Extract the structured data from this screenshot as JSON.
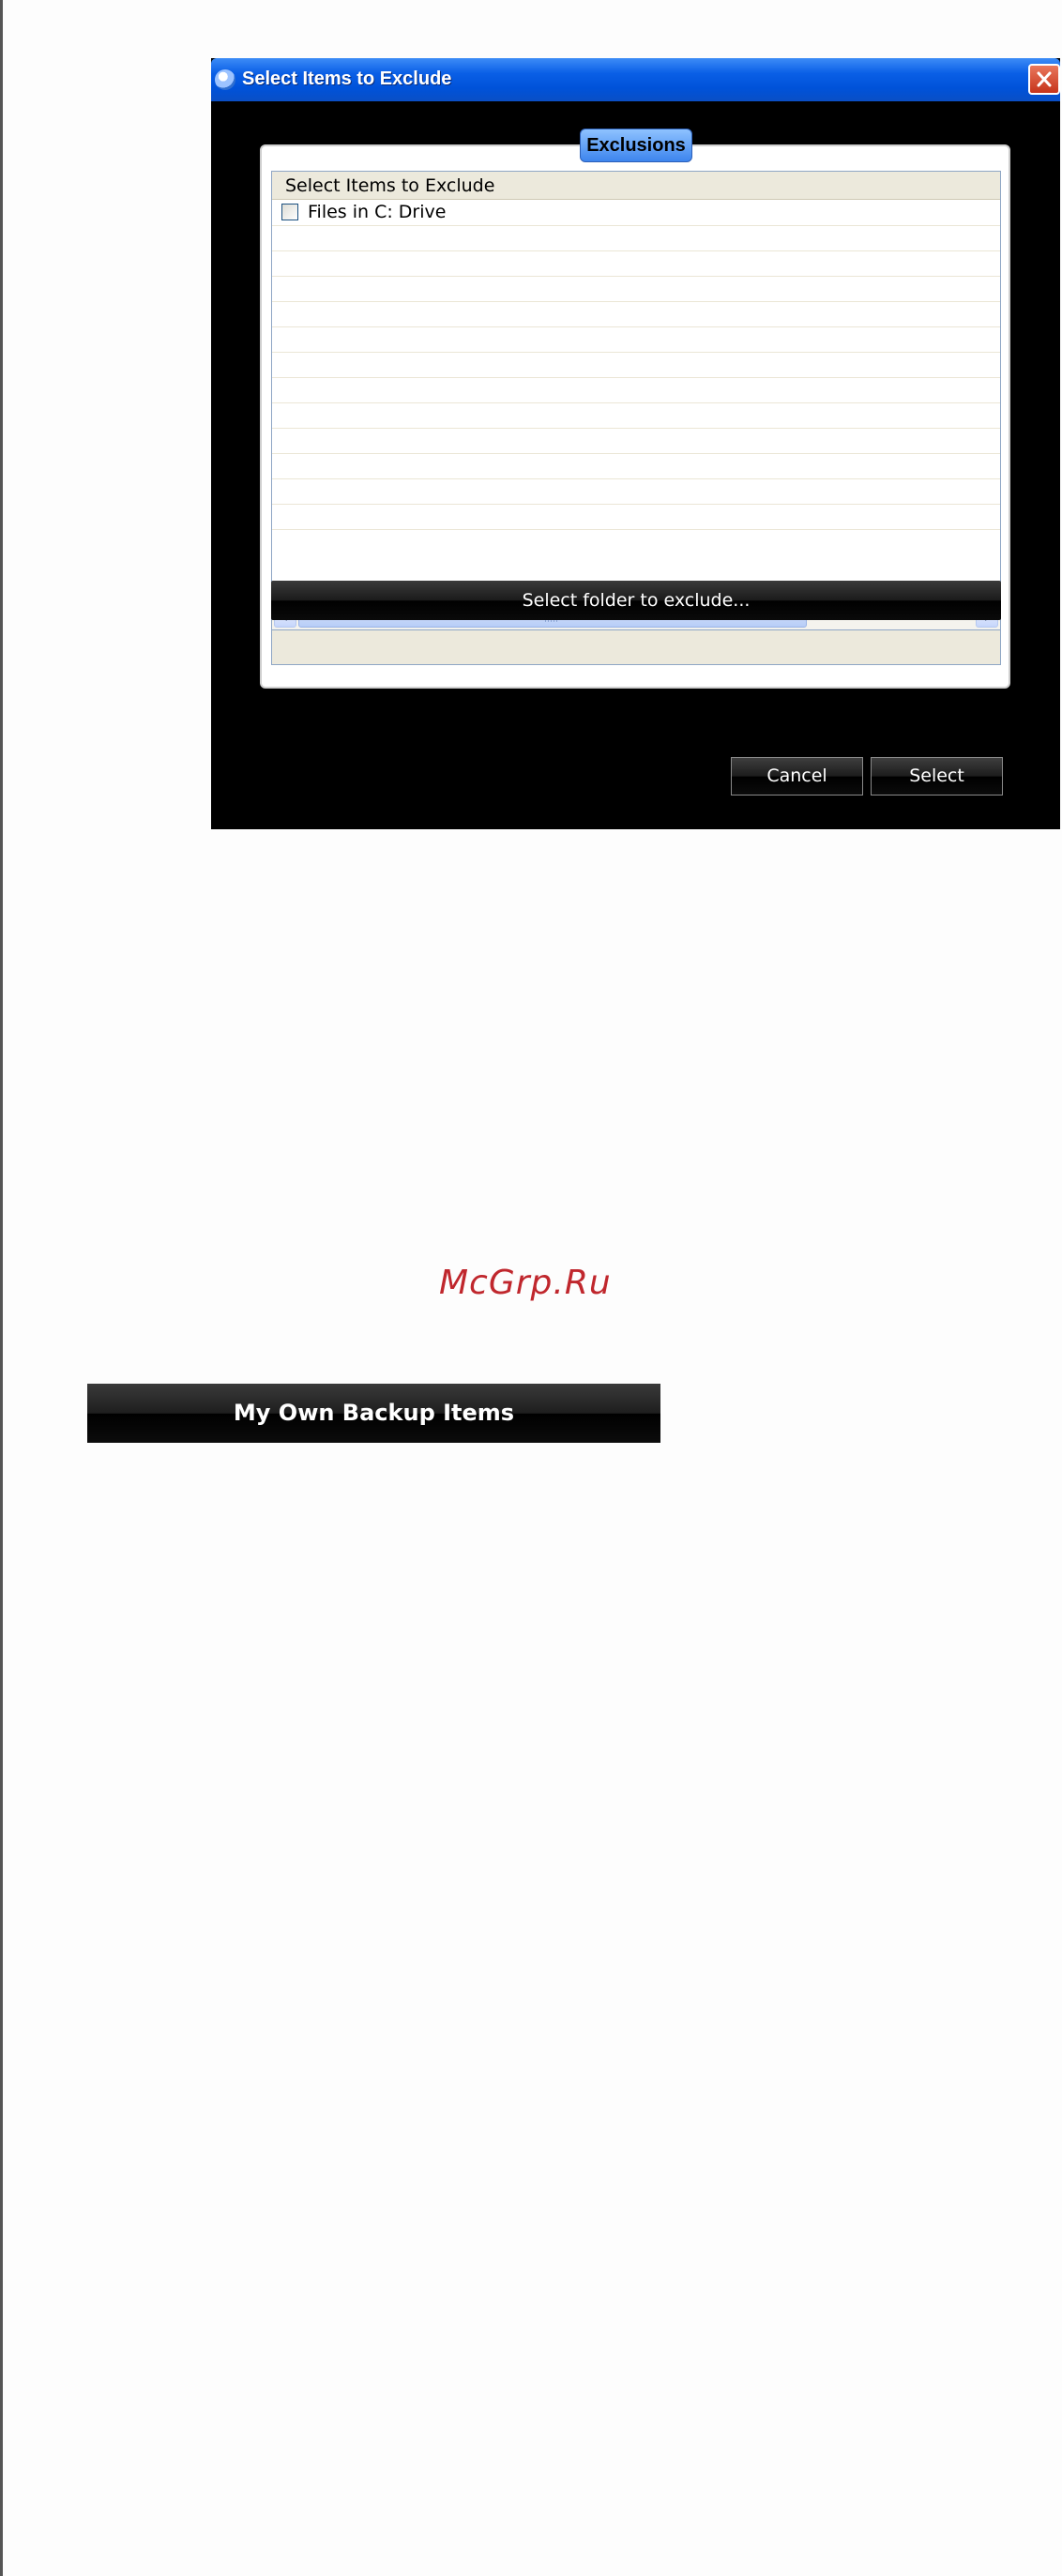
{
  "dialog": {
    "title": "Select Items to Exclude",
    "tab_label": "Exclusions",
    "list": {
      "header": "Select Items to Exclude",
      "items": [
        {
          "label": "Files in C: Drive",
          "checked": false
        }
      ]
    },
    "select_folder_label": "Select folder to exclude...",
    "path_value": "",
    "cancel_label": "Cancel",
    "select_label": "Select"
  },
  "watermark": "McGrp.Ru",
  "section_bar": {
    "label": "My Own Backup Items"
  },
  "colors": {
    "titlebar": "#0052d9",
    "dialog_bg": "#000000",
    "close": "#c6341b",
    "watermark": "#c0272d"
  },
  "icons": [
    "app-icon",
    "close-icon",
    "chevron-left-icon",
    "chevron-right-icon"
  ]
}
